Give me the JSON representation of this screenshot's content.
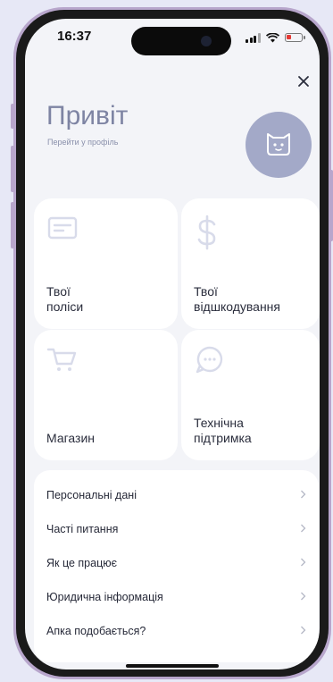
{
  "status": {
    "time": "16:37"
  },
  "header": {
    "greeting": "Привіт",
    "profile_link": "Перейти у профіль"
  },
  "cards": [
    {
      "id": "policies",
      "label": "Твої\nполіси",
      "icon": "card-icon"
    },
    {
      "id": "claims",
      "label": "Твої\nвідшкодування",
      "icon": "dollar-icon"
    },
    {
      "id": "shop",
      "label": "Магазин",
      "icon": "cart-icon"
    },
    {
      "id": "support",
      "label": "Технічна\nпідтримка",
      "icon": "chat-bubble-icon"
    }
  ],
  "menu": {
    "items": [
      {
        "label": "Персональні дані"
      },
      {
        "label": "Часті питання"
      },
      {
        "label": "Як це працює"
      },
      {
        "label": "Юридична інформація"
      },
      {
        "label": "Апка подобається?"
      }
    ]
  },
  "colors": {
    "accent": "#a3a9c8",
    "icon_tint": "#d8dbea",
    "background": "#f3f4f8",
    "frame": "#b8a6cc"
  }
}
